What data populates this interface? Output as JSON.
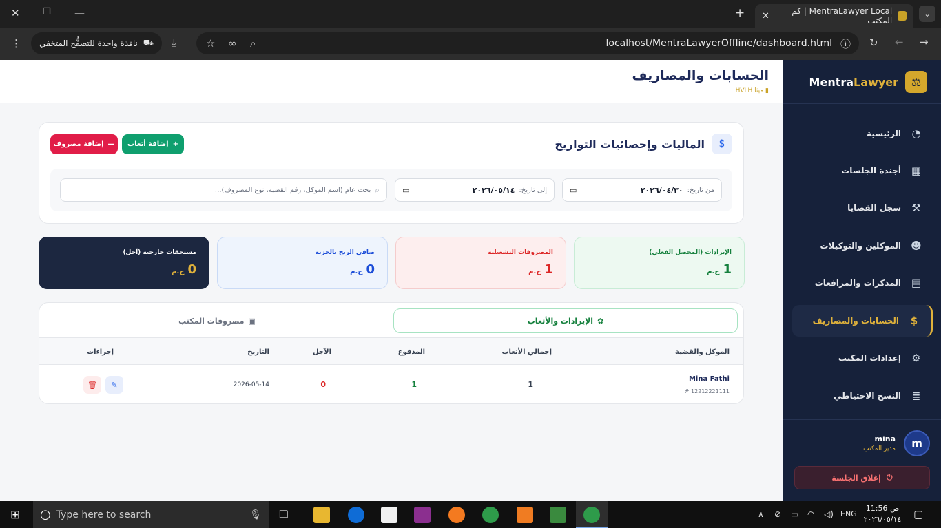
{
  "browser": {
    "tab_title": "MentraLawyer Local | كم المكتب",
    "url": "localhost/MentraLawyerOffline/dashboard.html",
    "incognito_label": "نافذة واحدة للتصفُّح المتخفي"
  },
  "sidebar": {
    "brand_a": "Mentra",
    "brand_b": "Lawyer",
    "items": [
      {
        "label": "الرئيسية",
        "icon": "◔"
      },
      {
        "label": "أجندة الجلسات",
        "icon": "▦"
      },
      {
        "label": "سجل القضايا",
        "icon": "⚒"
      },
      {
        "label": "الموكلين والتوكيلات",
        "icon": "☻"
      },
      {
        "label": "المذكرات والمرافعات",
        "icon": "▤"
      },
      {
        "label": "الحسابات والمصاريف",
        "icon": "$"
      },
      {
        "label": "إعدادات المكتب",
        "icon": "⚙"
      },
      {
        "label": "النسخ الاحتياطي",
        "icon": "≣"
      }
    ],
    "user": {
      "initial": "m",
      "name": "mina",
      "role": "مدير المكتب"
    },
    "logout": "إغلاق الجلسة"
  },
  "header": {
    "title": "الحسابات والمصاريف",
    "subtitle": "ميثا HVLH"
  },
  "finance": {
    "title": "الماليات وإحصائيات التواريخ",
    "add_fees": "إضافة أتعاب",
    "add_expense": "إضافة مصروف",
    "from_label": "من تاريخ:",
    "from_value": "٢٠٢٦/٠٤/٣٠",
    "to_label": "إلى تاريخ:",
    "to_value": "٢٠٢٦/٠٥/١٤",
    "search_placeholder": "بحث عام (اسم الموكل، رقم القضية، نوع المصروف)..."
  },
  "stats": [
    {
      "label": "الإيرادات (المحصل الفعلي)",
      "value": "1",
      "unit": "ج.م",
      "color": "#15803d"
    },
    {
      "label": "المصروفات التشغيلية",
      "value": "1",
      "unit": "ج.م",
      "color": "#dc2626"
    },
    {
      "label": "صافي الربح بالخزنة",
      "value": "0",
      "unit": "ج.م",
      "color": "#1d4ed8"
    },
    {
      "label": "مستحقات خارجية (آجل)",
      "value": "0",
      "unit": "ج.م",
      "color": "#e0b23b"
    }
  ],
  "tabs": {
    "income": "الإيرادات والأتعاب",
    "expenses": "مصروفات المكتب"
  },
  "table": {
    "headers": [
      "الموكل والقضية",
      "إجمالي الأتعاب",
      "المدفوع",
      "الآجل",
      "التاريخ",
      "إجراءات"
    ],
    "rows": [
      {
        "client": "Mina Fathi",
        "case": "# 12212221111",
        "total": "1",
        "paid": "1",
        "due": "0",
        "date": "2026-05-14"
      }
    ]
  },
  "taskbar": {
    "search_placeholder": "Type here to search",
    "lang": "ENG",
    "time": "11:56 ص",
    "date": "٢٠٢٦/٠٥/١٤"
  }
}
